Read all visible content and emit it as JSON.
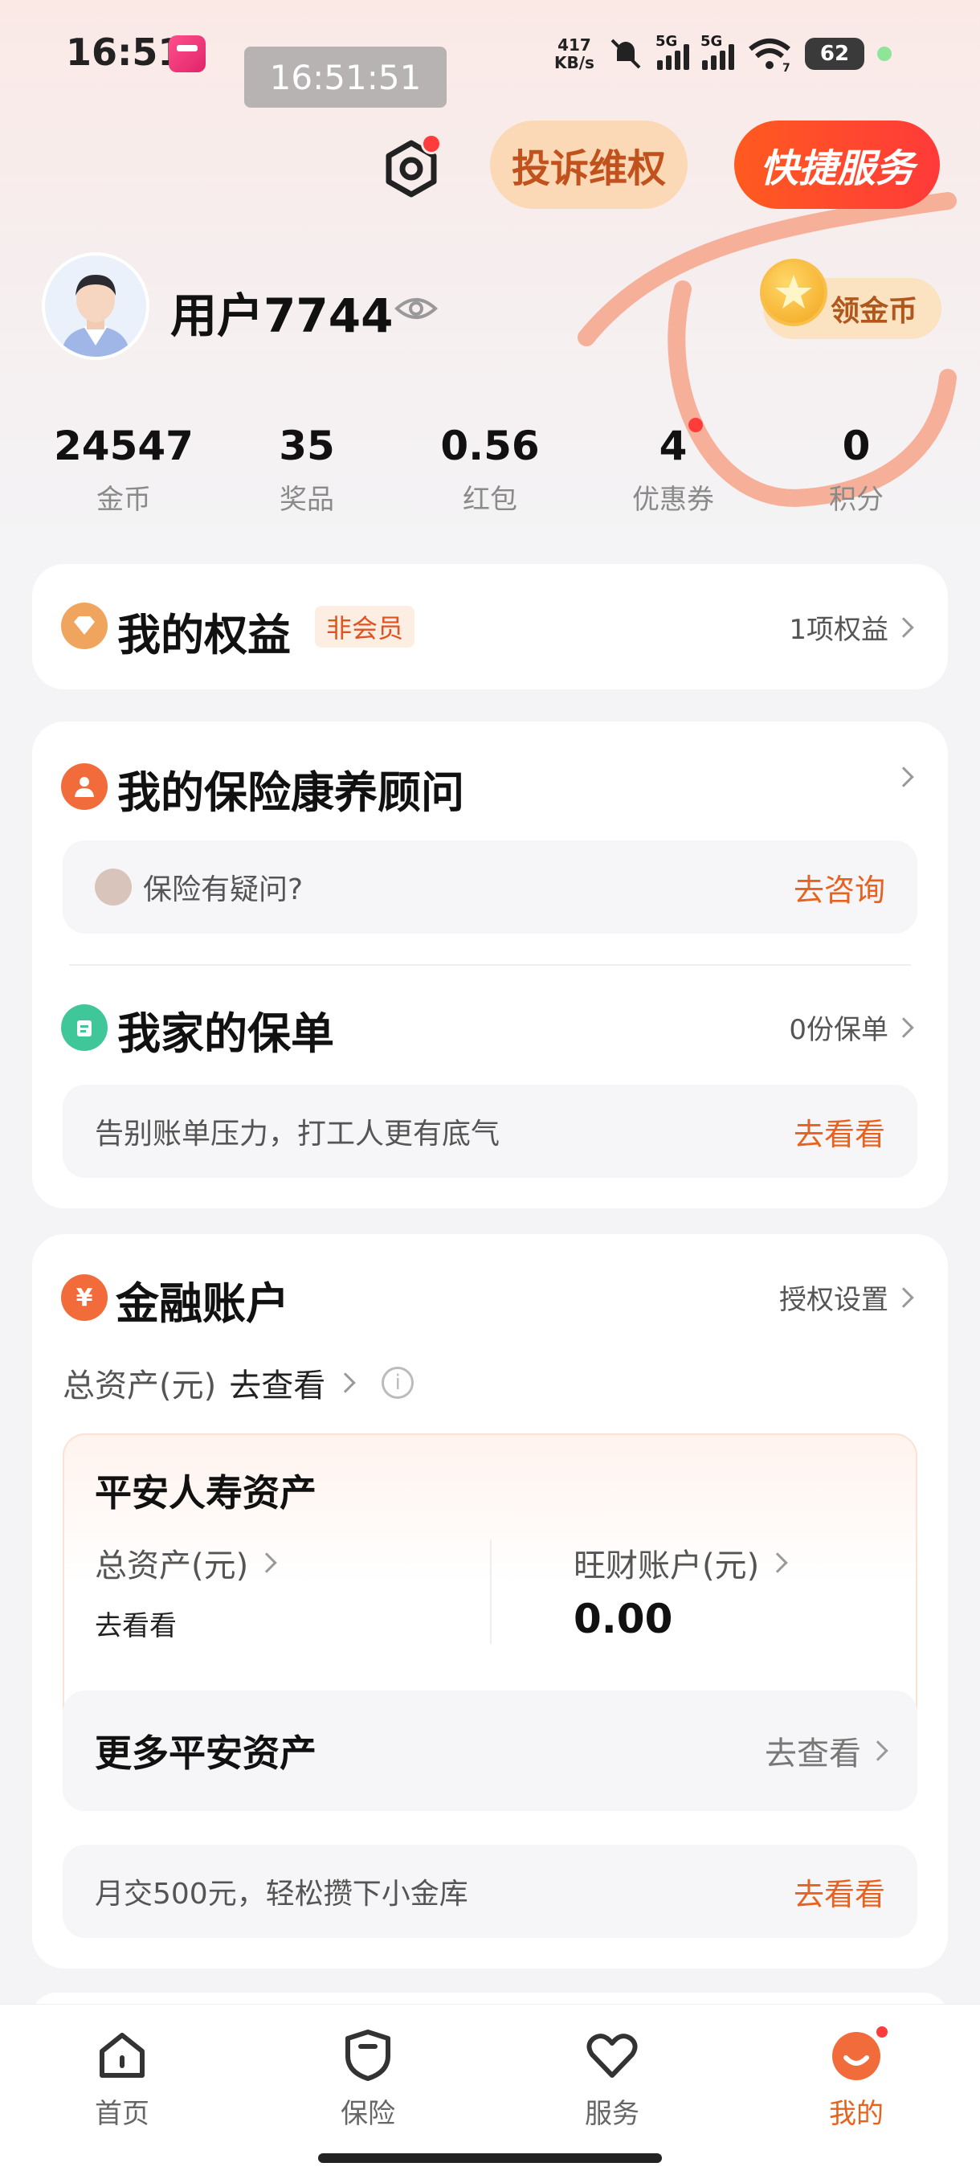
{
  "status_bar": {
    "time": "16:51",
    "time_overlay": "16:51:51",
    "net_speed_value": "417",
    "net_speed_unit": "KB/s",
    "sim1": "5G",
    "sim2": "5G",
    "wifi_sub": "7",
    "battery": "62"
  },
  "header": {
    "complain_label": "投诉维权",
    "quick_service_label": "快捷服务"
  },
  "user": {
    "name": "用户7744",
    "coin_button": "领金币"
  },
  "stats": [
    {
      "value": "24547",
      "label": "金币"
    },
    {
      "value": "35",
      "label": "奖品"
    },
    {
      "value": "0.56",
      "label": "红包"
    },
    {
      "value": "4",
      "label": "优惠券"
    },
    {
      "value": "0",
      "label": "积分"
    }
  ],
  "benefits": {
    "title": "我的权益",
    "badge": "非会员",
    "link": "1项权益"
  },
  "advisor": {
    "title": "我的保险康养顾问",
    "question": "保险有疑问?",
    "cta": "去咨询"
  },
  "policy": {
    "title": "我家的保单",
    "link": "0份保单",
    "slogan": "告别账单压力，打工人更有底气",
    "cta": "去看看"
  },
  "finance": {
    "title": "金融账户",
    "auth_link": "授权设置",
    "total_label": "总资产(元)",
    "total_action": "去查看",
    "pingan_title": "平安人寿资产",
    "pingan_total_label": "总资产(元)",
    "pingan_total_value": "去看看",
    "wangcai_label": "旺财账户(元)",
    "wangcai_value": "0.00",
    "more_title": "更多平安资产",
    "more_action": "去查看",
    "promo": "月交500元，轻松攒下小金库",
    "promo_cta": "去看看"
  },
  "tabs": [
    {
      "label": "首页",
      "icon": "home-icon"
    },
    {
      "label": "保险",
      "icon": "shield-icon"
    },
    {
      "label": "服务",
      "icon": "heart-icon"
    },
    {
      "label": "我的",
      "icon": "profile-face-icon",
      "active": true
    }
  ],
  "colors": {
    "accent": "#e8621f",
    "page_bg": "#f4f4f6"
  }
}
